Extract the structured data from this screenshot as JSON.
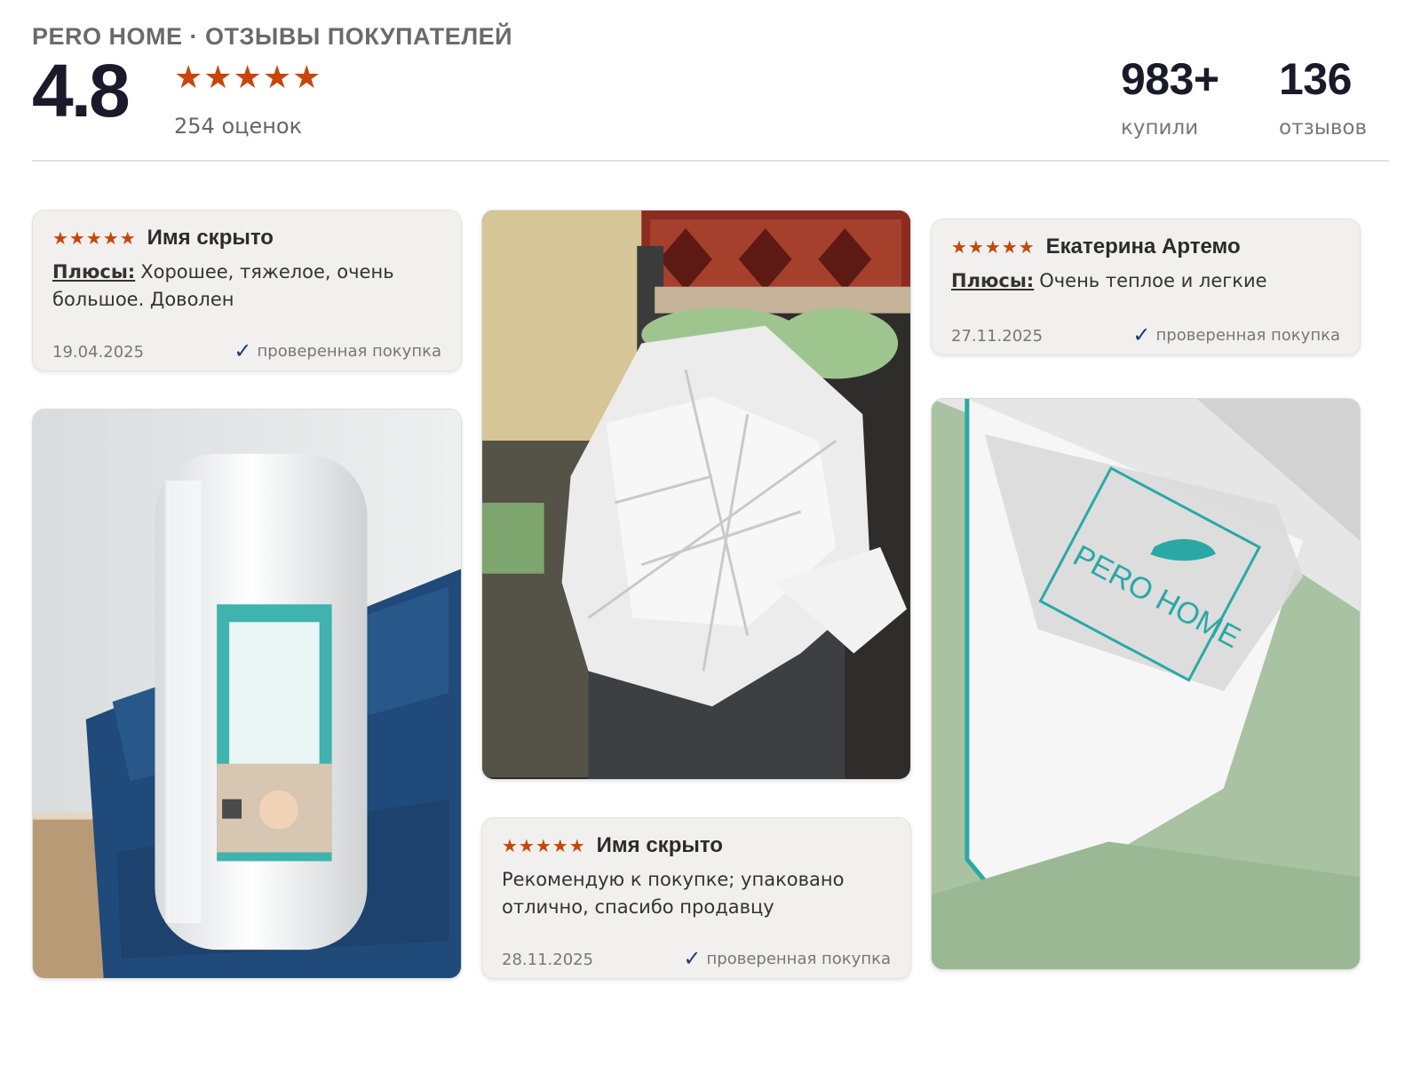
{
  "header": {
    "brand": "PERO HOME · ОТЗЫВЫ ПОКУПАТЕЛЕЙ",
    "score": "4.8",
    "stars": "★★★★★",
    "ratings_count": "254 оценок",
    "bought_value": "983+",
    "bought_label": "купили",
    "reviews_value": "136",
    "reviews_label": "отзывов"
  },
  "reviews": [
    {
      "stars": "★★★★★",
      "author": "Имя скрыто",
      "pros_label": "Плюсы:",
      "text": "Хорошее, тяжелое, очень большое. Доволен",
      "date": "19.04.2025",
      "verified": "проверенная покупка"
    },
    {
      "stars": "★★★★★",
      "author": "Екатерина Артемо",
      "pros_label": "Плюсы:",
      "text": "Очень теплое и легкие",
      "date": "27.11.2025",
      "verified": "проверенная покупка"
    },
    {
      "stars": "★★★★★",
      "author": "Имя скрыто",
      "text": "Рекомендую к покупке; упаковано отлично, спасибо продавцу",
      "date": "28.11.2025",
      "verified": "проверенная покупка"
    }
  ],
  "photo_label": {
    "brand": "PERO HOME"
  },
  "colors": {
    "star": "#c8450c",
    "check": "#1e3a74",
    "card_bg": "#f1f0ee",
    "teal": "#2aa8a6"
  }
}
